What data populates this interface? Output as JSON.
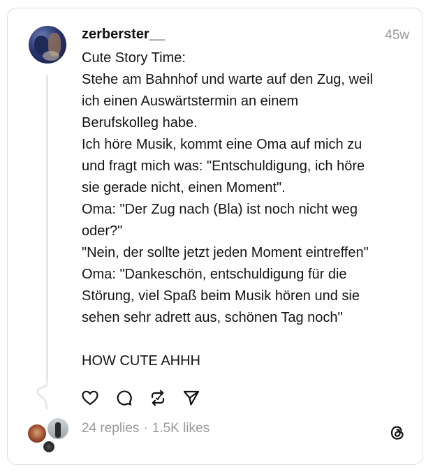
{
  "post": {
    "username": "zerberster__",
    "timestamp": "45w",
    "body_lines": [
      "Cute Story Time:",
      "Stehe am Bahnhof und warte auf den Zug, weil",
      "ich einen Auswärtstermin an einem",
      "Berufskolleg habe.",
      "Ich höre Musik, kommt eine Oma auf mich zu",
      "und fragt mich was: \"Entschuldigung, ich höre",
      "sie gerade nicht, einen Moment\".",
      "Oma: \"Der Zug nach (Bla) ist noch nicht weg",
      "oder?\"",
      "\"Nein, der sollte jetzt jeden Moment eintreffen\"",
      "Oma: \"Dankeschön, entschuldigung für die",
      "Störung, viel Spaß beim Musik hören und sie",
      "sehen sehr adrett aus, schönen Tag noch\"",
      "",
      "HOW CUTE AHHH"
    ]
  },
  "actions": {
    "icons": [
      "heart-icon",
      "comment-icon",
      "repost-icon",
      "share-icon"
    ]
  },
  "stats": {
    "replies": "24 replies",
    "separator": "·",
    "likes": "1.5K likes"
  },
  "colors": {
    "text": "#141414",
    "muted": "#9a9a9a",
    "border": "#dedede"
  }
}
